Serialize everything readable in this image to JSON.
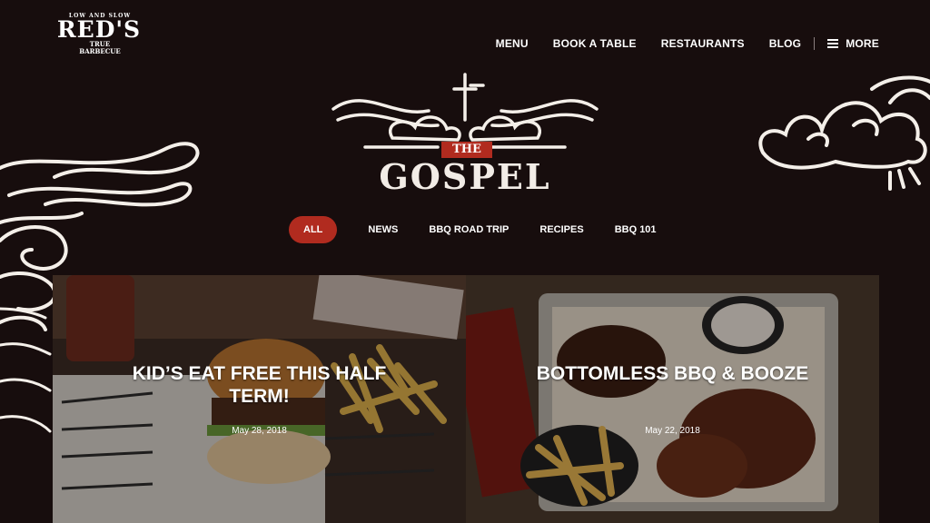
{
  "logo": {
    "tagline": "LOW AND SLOW",
    "name": "RED'S",
    "sub1": "TRUE",
    "sub2": "BARBECUE"
  },
  "nav": {
    "items": [
      "MENU",
      "BOOK A TABLE",
      "RESTAURANTS",
      "BLOG"
    ],
    "more": "MORE"
  },
  "heading": {
    "badge": "THE",
    "title": "GOSPEL"
  },
  "filters": {
    "active": "ALL",
    "items": [
      "NEWS",
      "BBQ ROAD TRIP",
      "RECIPES",
      "BBQ 101"
    ]
  },
  "cards": [
    {
      "title": "KID’S EAT FREE THIS HALF TERM!",
      "date": "May 28, 2018"
    },
    {
      "title": "BOTTOMLESS BBQ & BOOZE",
      "date": "May 22, 2018"
    }
  ],
  "colors": {
    "background": "#170d0d",
    "accent": "#b12b1f"
  }
}
